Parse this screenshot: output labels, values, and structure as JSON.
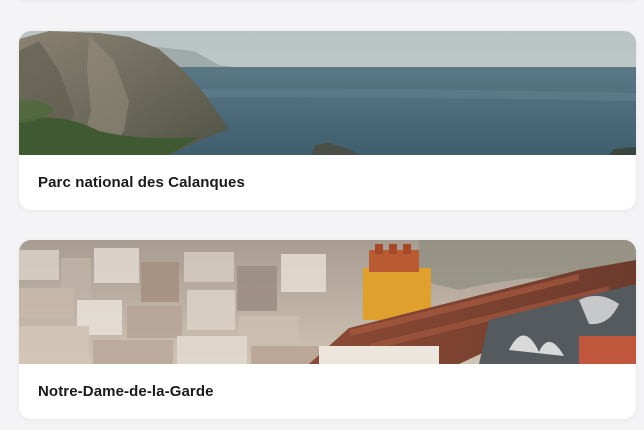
{
  "places": [
    {
      "name": "Parc national des Calanques",
      "image_subject": "calanques-coastline-photo"
    },
    {
      "name": "Notre-Dame-de-la-Garde",
      "image_subject": "marseille-rooftops-photo"
    }
  ],
  "colors": {
    "background": "#f4f4f6",
    "card": "#ffffff",
    "title_text": "#1a1a1a"
  }
}
